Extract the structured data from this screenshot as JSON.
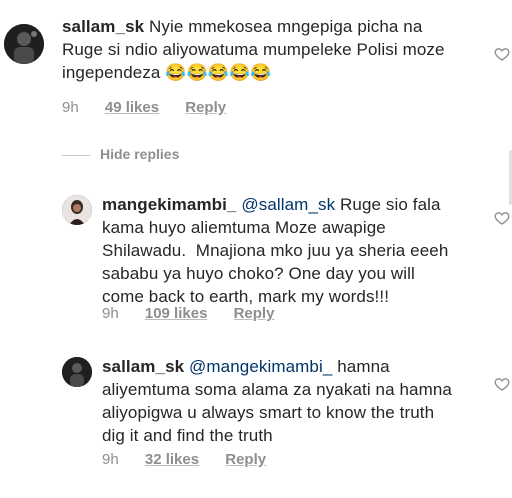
{
  "comments": [
    {
      "username": "sallam_sk",
      "mention": "",
      "text_before_emoji": "Nyie mmekosea mngepiga picha na\nRuge si ndio aliyowatuma mumpeleke Polisi moze\ningependeza ",
      "emoji": "😂😂😂😂😂",
      "time": "9h",
      "likes": "49 likes",
      "reply": "Reply",
      "icon": "heart-outline-icon"
    },
    {
      "username": "mangekimambi_",
      "mention": "@sallam_sk",
      "text_before_emoji": " Ruge sio fala\nkama huyo aliemtuma Moze awapige\nShilawadu.  Mnajiona mko juu ya sheria eeeh\nsababu ya huyo choko? One day you will\ncome back to earth, mark my words!!!",
      "emoji": "",
      "time": "9h",
      "likes": "109 likes",
      "reply": "Reply",
      "icon": "heart-outline-icon"
    },
    {
      "username": "sallam_sk",
      "mention": "@mangekimambi_",
      "text_before_emoji": " hamna\naliyemtuma soma alama za nyakati na hamna\naliyopigwa u always smart to know the truth\ndig it and find the truth",
      "emoji": "",
      "time": "9h",
      "likes": "32 likes",
      "reply": "Reply",
      "icon": "heart-outline-icon"
    }
  ],
  "hide_replies": "Hide replies",
  "colors": {
    "text": "#262626",
    "muted": "#8e8e8e",
    "mention": "#003569"
  }
}
